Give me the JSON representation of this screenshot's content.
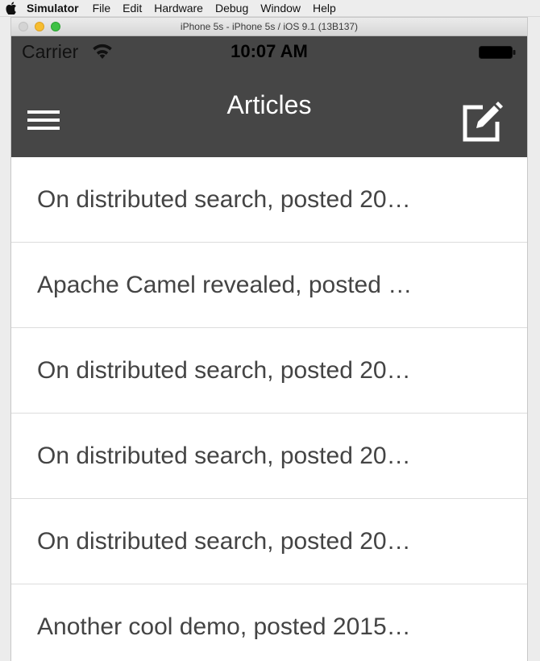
{
  "menubar": {
    "app": "Simulator",
    "items": [
      "File",
      "Edit",
      "Hardware",
      "Debug",
      "Window",
      "Help"
    ]
  },
  "window": {
    "title": "iPhone 5s - iPhone 5s / iOS 9.1 (13B137)"
  },
  "statusbar": {
    "carrier": "Carrier",
    "time": "10:07 AM"
  },
  "navbar": {
    "title": "Articles",
    "left_icon": "hamburger-menu-icon",
    "right_icon": "compose-icon"
  },
  "articles": [
    "On distributed search, posted 20…",
    "Apache Camel revealed, posted …",
    "On distributed search, posted 20…",
    "On distributed search, posted 20…",
    "On distributed search, posted 20…",
    "Another cool demo, posted 2015…"
  ],
  "colors": {
    "navbar": "#464646",
    "title": "#ffffff",
    "row_text": "#444444",
    "separator": "#dcdcdc"
  }
}
